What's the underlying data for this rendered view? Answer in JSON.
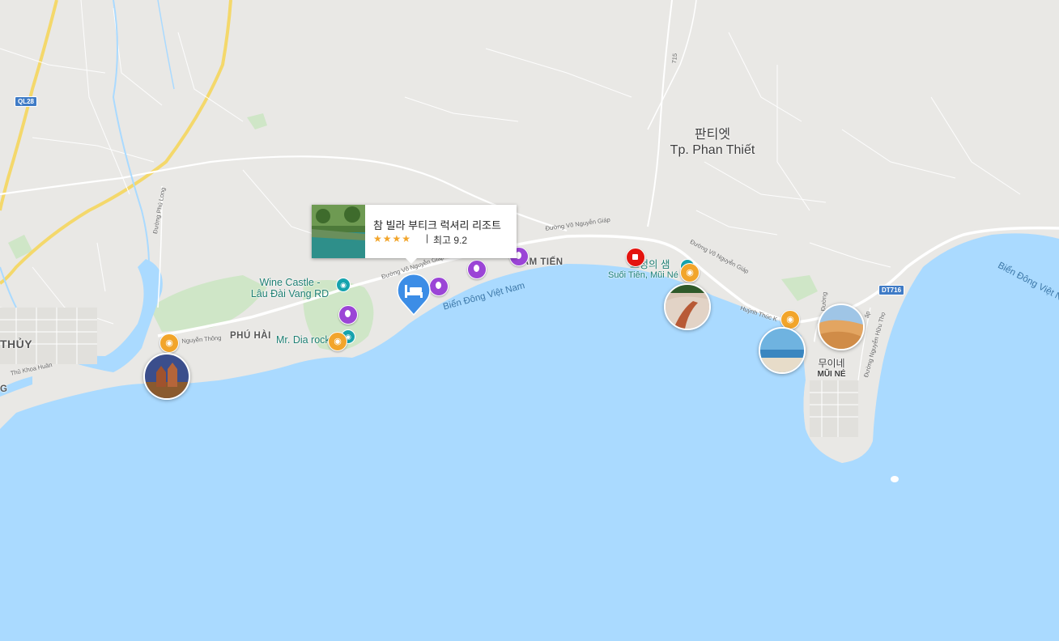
{
  "map": {
    "city_name_ko": "판티엣",
    "city_name_vi": "Tp. Phan Thiết",
    "districts": {
      "phu_hai": "PHÚ HÀI",
      "ham_tien": "HÀM TIẾN",
      "thuy": "THỦY",
      "mui_ne_ko": "무이네",
      "mui_ne_vi": "MŨI NÉ",
      "edge_g": "G"
    },
    "pois": {
      "wine_castle_line1": "Wine Castle -",
      "wine_castle_line2": "Lâu Đài Vang RD",
      "mr_dia_rock": "Mr. Dia rock",
      "fairy_stream_ko": "요정의 샘",
      "fairy_stream_vi": "Suối Tiên, Mũi Né"
    },
    "sea_labels": {
      "bien_dong_1": "Biển Đông Việt Nam",
      "bien_dong_2": "Biển Đông Việt N"
    },
    "streets": {
      "vo_nguyen_giap_1": "Đường Võ Nguyễn Giáp",
      "vo_nguyen_giap_2": "Đường Võ Nguyễn Giáp",
      "vo_nguyen_giap_3": "Đường Võ Nguyễn Giáp",
      "huynh_thuc_khang": "Huỳnh Thúc K",
      "nguyen_thong": "Nguyễn Thông",
      "thu_khoa_huan": "Thủ Khoa Huân",
      "phu_long": "Đường Phú Long",
      "nguyen_huu_tho": "Đường Nguyễn Hữu Thọ",
      "road_715": "715",
      "duong_short": "Đường",
      "ap": "ấp"
    },
    "shields": {
      "ql28": "QL28",
      "dt716": "DT716"
    },
    "icons": {
      "camera": "camera-icon",
      "hotel": "bed-icon",
      "shopping": "shopping-bag-icon",
      "attraction": "pin-icon"
    },
    "colors": {
      "water": "#aadaff",
      "land": "#e9e8e5",
      "park": "#c8e4c0",
      "camera_marker": "#f2a52b",
      "hotel_marker": "#3c8de6",
      "attraction_marker": "#9b45d6",
      "shopping_marker": "#e3140f",
      "poi_text": "#1e7f73"
    }
  },
  "popup": {
    "hotel_name": "참 빌라 부티크 럭셔리 리조트",
    "stars": "★★★★",
    "star_count": 4,
    "separator": "|",
    "rating_text": "최고 9.2"
  }
}
